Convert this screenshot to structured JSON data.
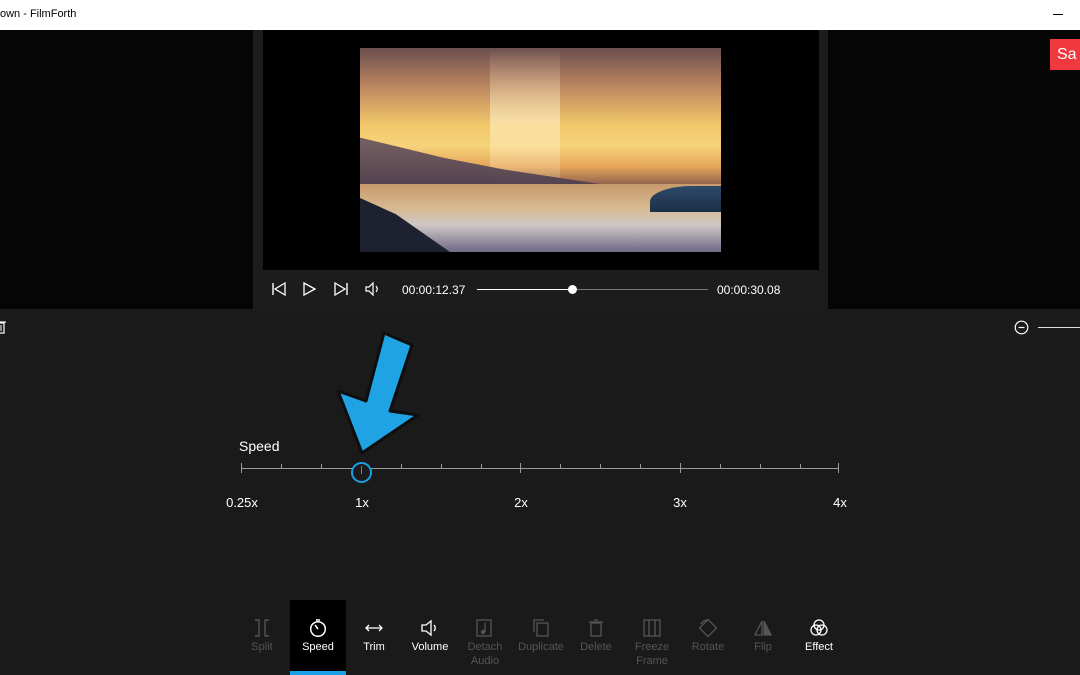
{
  "window": {
    "title": "own - FilmForth"
  },
  "player": {
    "current_time": "00:00:12.37",
    "total_time": "00:00:30.08",
    "progress": 0.41
  },
  "save_button": {
    "label": "Sa"
  },
  "speed": {
    "title": "Speed",
    "labels": [
      "0.25x",
      "1x",
      "2x",
      "3x",
      "4x"
    ],
    "current_value": "1x"
  },
  "toolbar": {
    "tools": [
      {
        "label": "Split",
        "enabled": false
      },
      {
        "label": "Speed",
        "enabled": true,
        "active": true
      },
      {
        "label": "Trim",
        "enabled": true
      },
      {
        "label": "Volume",
        "enabled": true
      },
      {
        "label": "Detach\nAudio",
        "enabled": false
      },
      {
        "label": "Duplicate",
        "enabled": false
      },
      {
        "label": "Delete",
        "enabled": false
      },
      {
        "label": "Freeze\nFrame",
        "enabled": false
      },
      {
        "label": "Rotate",
        "enabled": false
      },
      {
        "label": "Flip",
        "enabled": false
      },
      {
        "label": "Effect",
        "enabled": true
      }
    ]
  },
  "colors": {
    "accent": "#1aa0e6",
    "save": "#f0393e",
    "disabled_text": "#555555"
  }
}
